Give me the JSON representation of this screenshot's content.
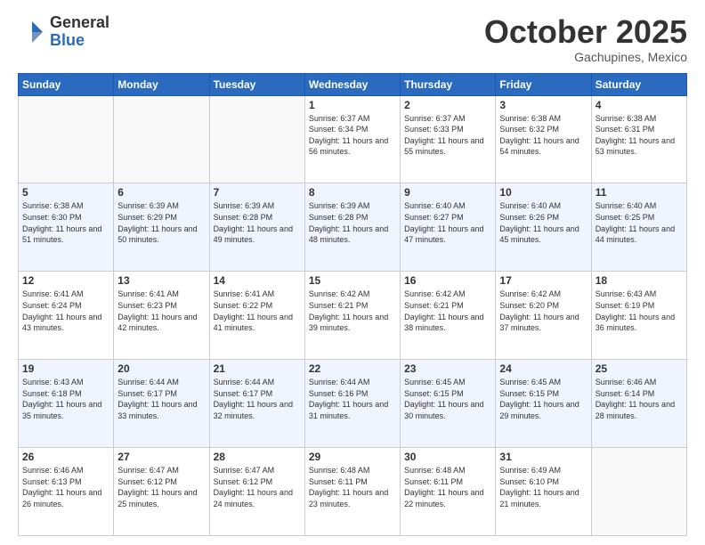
{
  "header": {
    "logo_general": "General",
    "logo_blue": "Blue",
    "month": "October 2025",
    "location": "Gachupines, Mexico"
  },
  "weekdays": [
    "Sunday",
    "Monday",
    "Tuesday",
    "Wednesday",
    "Thursday",
    "Friday",
    "Saturday"
  ],
  "weeks": [
    [
      {
        "day": "",
        "sunrise": "",
        "sunset": "",
        "daylight": ""
      },
      {
        "day": "",
        "sunrise": "",
        "sunset": "",
        "daylight": ""
      },
      {
        "day": "",
        "sunrise": "",
        "sunset": "",
        "daylight": ""
      },
      {
        "day": "1",
        "sunrise": "Sunrise: 6:37 AM",
        "sunset": "Sunset: 6:34 PM",
        "daylight": "Daylight: 11 hours and 56 minutes."
      },
      {
        "day": "2",
        "sunrise": "Sunrise: 6:37 AM",
        "sunset": "Sunset: 6:33 PM",
        "daylight": "Daylight: 11 hours and 55 minutes."
      },
      {
        "day": "3",
        "sunrise": "Sunrise: 6:38 AM",
        "sunset": "Sunset: 6:32 PM",
        "daylight": "Daylight: 11 hours and 54 minutes."
      },
      {
        "day": "4",
        "sunrise": "Sunrise: 6:38 AM",
        "sunset": "Sunset: 6:31 PM",
        "daylight": "Daylight: 11 hours and 53 minutes."
      }
    ],
    [
      {
        "day": "5",
        "sunrise": "Sunrise: 6:38 AM",
        "sunset": "Sunset: 6:30 PM",
        "daylight": "Daylight: 11 hours and 51 minutes."
      },
      {
        "day": "6",
        "sunrise": "Sunrise: 6:39 AM",
        "sunset": "Sunset: 6:29 PM",
        "daylight": "Daylight: 11 hours and 50 minutes."
      },
      {
        "day": "7",
        "sunrise": "Sunrise: 6:39 AM",
        "sunset": "Sunset: 6:28 PM",
        "daylight": "Daylight: 11 hours and 49 minutes."
      },
      {
        "day": "8",
        "sunrise": "Sunrise: 6:39 AM",
        "sunset": "Sunset: 6:28 PM",
        "daylight": "Daylight: 11 hours and 48 minutes."
      },
      {
        "day": "9",
        "sunrise": "Sunrise: 6:40 AM",
        "sunset": "Sunset: 6:27 PM",
        "daylight": "Daylight: 11 hours and 47 minutes."
      },
      {
        "day": "10",
        "sunrise": "Sunrise: 6:40 AM",
        "sunset": "Sunset: 6:26 PM",
        "daylight": "Daylight: 11 hours and 45 minutes."
      },
      {
        "day": "11",
        "sunrise": "Sunrise: 6:40 AM",
        "sunset": "Sunset: 6:25 PM",
        "daylight": "Daylight: 11 hours and 44 minutes."
      }
    ],
    [
      {
        "day": "12",
        "sunrise": "Sunrise: 6:41 AM",
        "sunset": "Sunset: 6:24 PM",
        "daylight": "Daylight: 11 hours and 43 minutes."
      },
      {
        "day": "13",
        "sunrise": "Sunrise: 6:41 AM",
        "sunset": "Sunset: 6:23 PM",
        "daylight": "Daylight: 11 hours and 42 minutes."
      },
      {
        "day": "14",
        "sunrise": "Sunrise: 6:41 AM",
        "sunset": "Sunset: 6:22 PM",
        "daylight": "Daylight: 11 hours and 41 minutes."
      },
      {
        "day": "15",
        "sunrise": "Sunrise: 6:42 AM",
        "sunset": "Sunset: 6:21 PM",
        "daylight": "Daylight: 11 hours and 39 minutes."
      },
      {
        "day": "16",
        "sunrise": "Sunrise: 6:42 AM",
        "sunset": "Sunset: 6:21 PM",
        "daylight": "Daylight: 11 hours and 38 minutes."
      },
      {
        "day": "17",
        "sunrise": "Sunrise: 6:42 AM",
        "sunset": "Sunset: 6:20 PM",
        "daylight": "Daylight: 11 hours and 37 minutes."
      },
      {
        "day": "18",
        "sunrise": "Sunrise: 6:43 AM",
        "sunset": "Sunset: 6:19 PM",
        "daylight": "Daylight: 11 hours and 36 minutes."
      }
    ],
    [
      {
        "day": "19",
        "sunrise": "Sunrise: 6:43 AM",
        "sunset": "Sunset: 6:18 PM",
        "daylight": "Daylight: 11 hours and 35 minutes."
      },
      {
        "day": "20",
        "sunrise": "Sunrise: 6:44 AM",
        "sunset": "Sunset: 6:17 PM",
        "daylight": "Daylight: 11 hours and 33 minutes."
      },
      {
        "day": "21",
        "sunrise": "Sunrise: 6:44 AM",
        "sunset": "Sunset: 6:17 PM",
        "daylight": "Daylight: 11 hours and 32 minutes."
      },
      {
        "day": "22",
        "sunrise": "Sunrise: 6:44 AM",
        "sunset": "Sunset: 6:16 PM",
        "daylight": "Daylight: 11 hours and 31 minutes."
      },
      {
        "day": "23",
        "sunrise": "Sunrise: 6:45 AM",
        "sunset": "Sunset: 6:15 PM",
        "daylight": "Daylight: 11 hours and 30 minutes."
      },
      {
        "day": "24",
        "sunrise": "Sunrise: 6:45 AM",
        "sunset": "Sunset: 6:15 PM",
        "daylight": "Daylight: 11 hours and 29 minutes."
      },
      {
        "day": "25",
        "sunrise": "Sunrise: 6:46 AM",
        "sunset": "Sunset: 6:14 PM",
        "daylight": "Daylight: 11 hours and 28 minutes."
      }
    ],
    [
      {
        "day": "26",
        "sunrise": "Sunrise: 6:46 AM",
        "sunset": "Sunset: 6:13 PM",
        "daylight": "Daylight: 11 hours and 26 minutes."
      },
      {
        "day": "27",
        "sunrise": "Sunrise: 6:47 AM",
        "sunset": "Sunset: 6:12 PM",
        "daylight": "Daylight: 11 hours and 25 minutes."
      },
      {
        "day": "28",
        "sunrise": "Sunrise: 6:47 AM",
        "sunset": "Sunset: 6:12 PM",
        "daylight": "Daylight: 11 hours and 24 minutes."
      },
      {
        "day": "29",
        "sunrise": "Sunrise: 6:48 AM",
        "sunset": "Sunset: 6:11 PM",
        "daylight": "Daylight: 11 hours and 23 minutes."
      },
      {
        "day": "30",
        "sunrise": "Sunrise: 6:48 AM",
        "sunset": "Sunset: 6:11 PM",
        "daylight": "Daylight: 11 hours and 22 minutes."
      },
      {
        "day": "31",
        "sunrise": "Sunrise: 6:49 AM",
        "sunset": "Sunset: 6:10 PM",
        "daylight": "Daylight: 11 hours and 21 minutes."
      },
      {
        "day": "",
        "sunrise": "",
        "sunset": "",
        "daylight": ""
      }
    ]
  ]
}
